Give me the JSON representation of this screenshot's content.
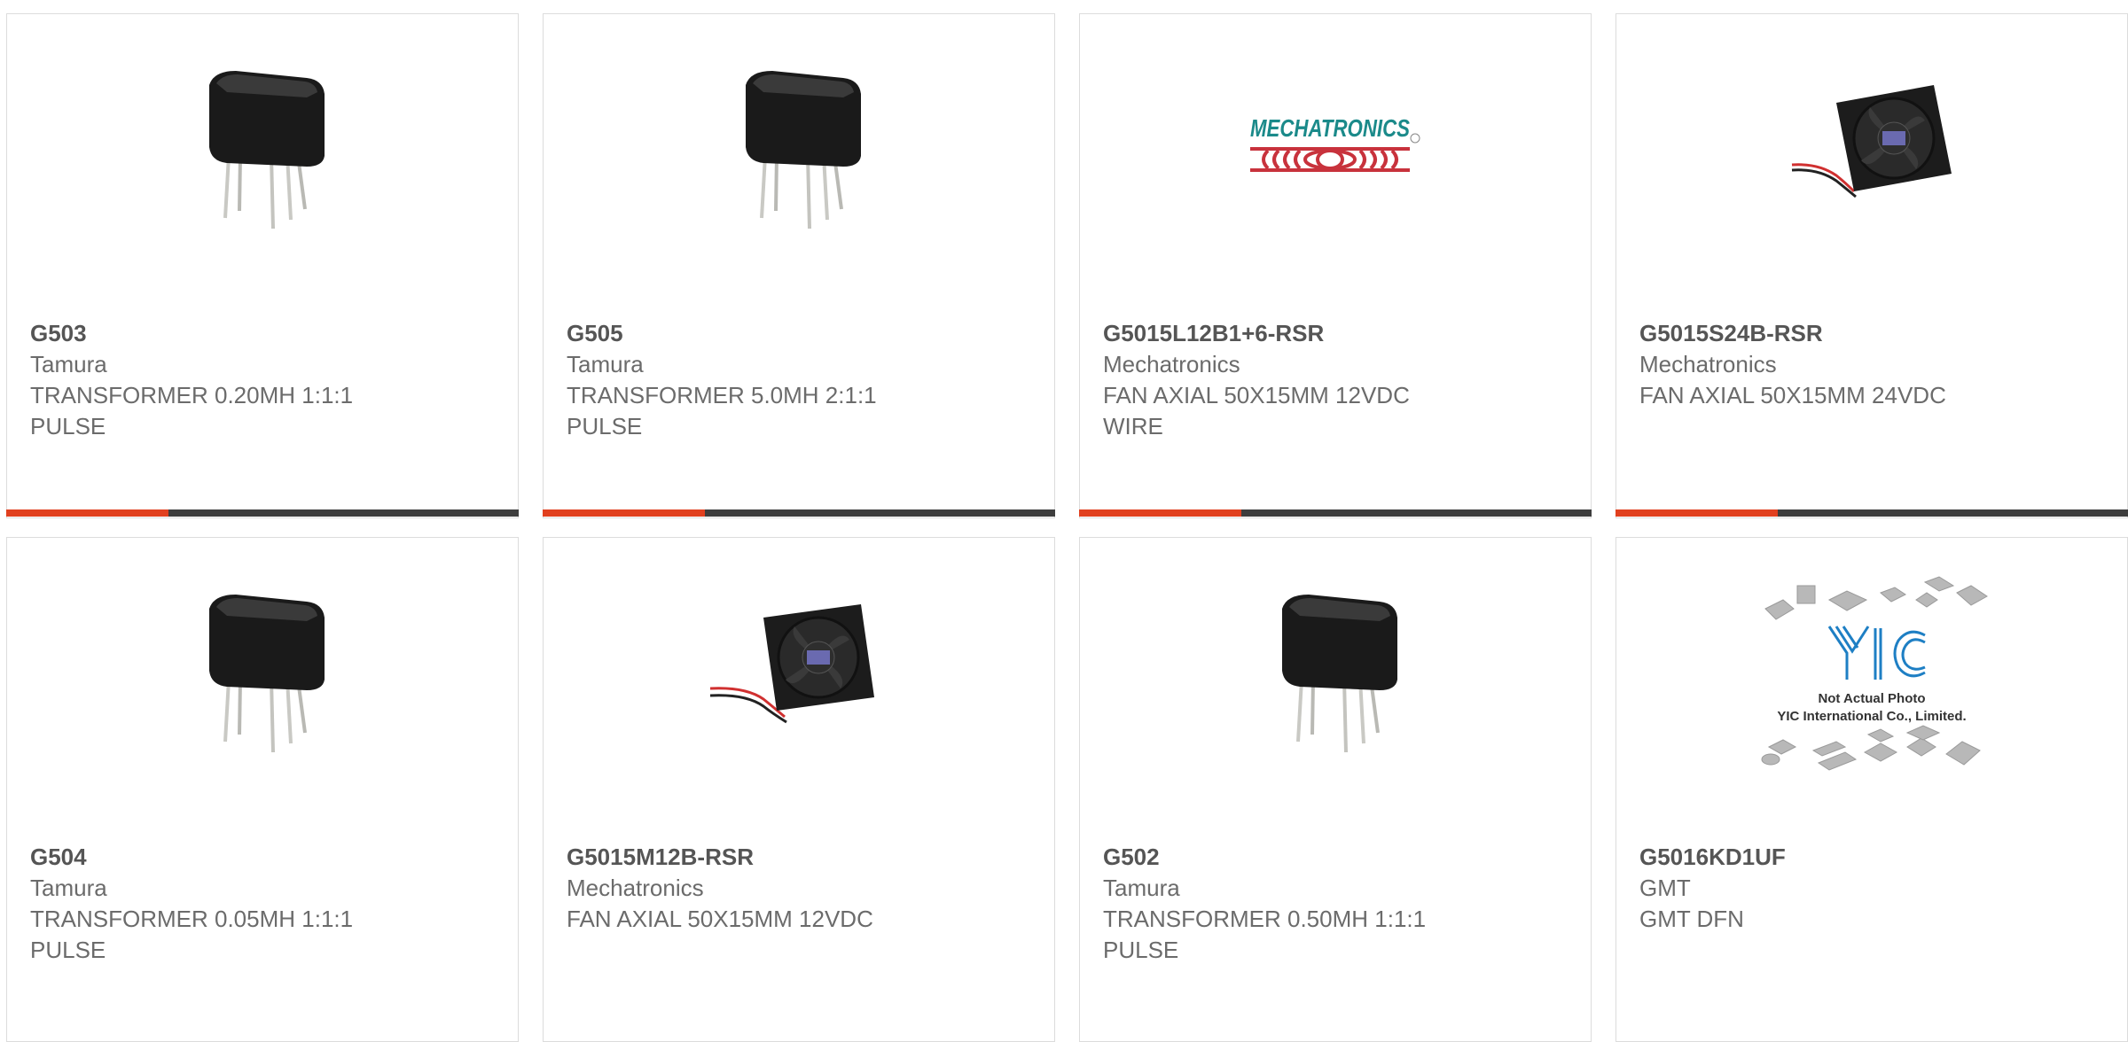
{
  "products": [
    {
      "part": "G503",
      "maker": "Tamura",
      "desc": "TRANSFORMER 0.20MH 1:1:1\nPULSE",
      "image": "transformer"
    },
    {
      "part": "G505",
      "maker": "Tamura",
      "desc": "TRANSFORMER 5.0MH 2:1:1\nPULSE",
      "image": "transformer"
    },
    {
      "part": "G5015L12B1+6-RSR",
      "maker": "Mechatronics",
      "desc": "FAN AXIAL 50X15MM 12VDC\nWIRE",
      "image": "mechatronics-logo"
    },
    {
      "part": "G5015S24B-RSR",
      "maker": "Mechatronics",
      "desc": "FAN AXIAL 50X15MM 24VDC",
      "image": "fan"
    },
    {
      "part": "G504",
      "maker": "Tamura",
      "desc": "TRANSFORMER 0.05MH 1:1:1\nPULSE",
      "image": "transformer"
    },
    {
      "part": "G5015M12B-RSR",
      "maker": "Mechatronics",
      "desc": "FAN AXIAL 50X15MM 12VDC",
      "image": "fan"
    },
    {
      "part": "G502",
      "maker": "Tamura",
      "desc": "TRANSFORMER 0.50MH 1:1:1\nPULSE",
      "image": "transformer"
    },
    {
      "part": "G5016KD1UF",
      "maker": "GMT",
      "desc": "GMT DFN",
      "image": "yic-placeholder"
    }
  ],
  "logo_text": {
    "mechatronics": "MECHATRONICS",
    "yic_line1": "Not Actual Photo",
    "yic_line2": "YIC International Co., Limited."
  },
  "colors": {
    "accent": "#e1401f",
    "bar": "#3d3d3d",
    "mechatronics_teal": "#1b8a8a",
    "mechatronics_red": "#c8323c",
    "yic_blue": "#1e7fc4"
  }
}
